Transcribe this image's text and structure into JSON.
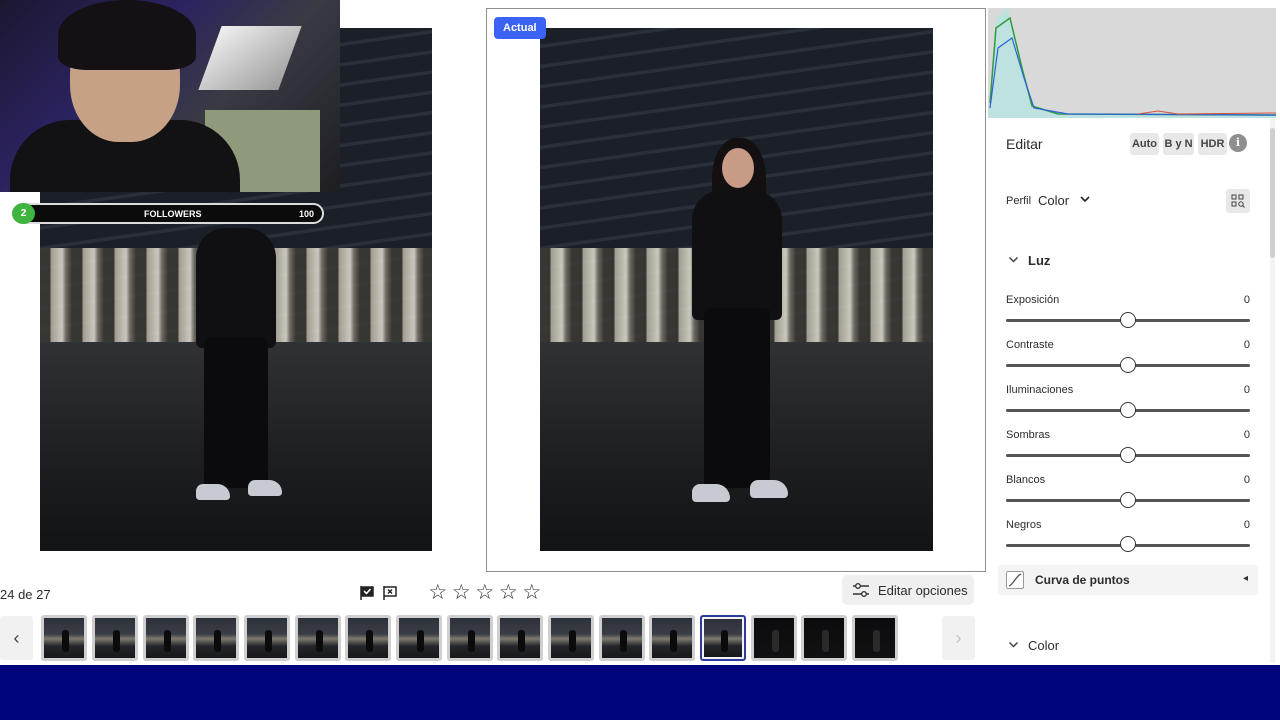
{
  "compare": {
    "actual_badge": "Actual"
  },
  "overlay": {
    "followers_count": "2",
    "followers_label": "FOLLOWERS",
    "followers_goal": "100"
  },
  "toolbar": {
    "counter": "24 de 27",
    "edit_options_label": "Editar opciones",
    "rating_stars": 5
  },
  "filmstrip": {
    "thumb_count": 17,
    "selected_index": 13
  },
  "panel": {
    "edit_title": "Editar",
    "mode_buttons": [
      "Auto",
      "B y N",
      "HDR"
    ],
    "profile_label": "Perfil",
    "profile_value": "Color",
    "light_section": "Luz",
    "sliders": [
      {
        "label": "Exposición",
        "value": "0"
      },
      {
        "label": "Contraste",
        "value": "0"
      },
      {
        "label": "Iluminaciones",
        "value": "0"
      },
      {
        "label": "Sombras",
        "value": "0"
      },
      {
        "label": "Blancos",
        "value": "0"
      },
      {
        "label": "Negros",
        "value": "0"
      }
    ],
    "curve_label": "Curva de puntos",
    "color_section": "Color"
  },
  "colors": {
    "accent": "#3b63f3",
    "bottom_band": "#00057d",
    "followers_badge": "#3fb53f"
  }
}
